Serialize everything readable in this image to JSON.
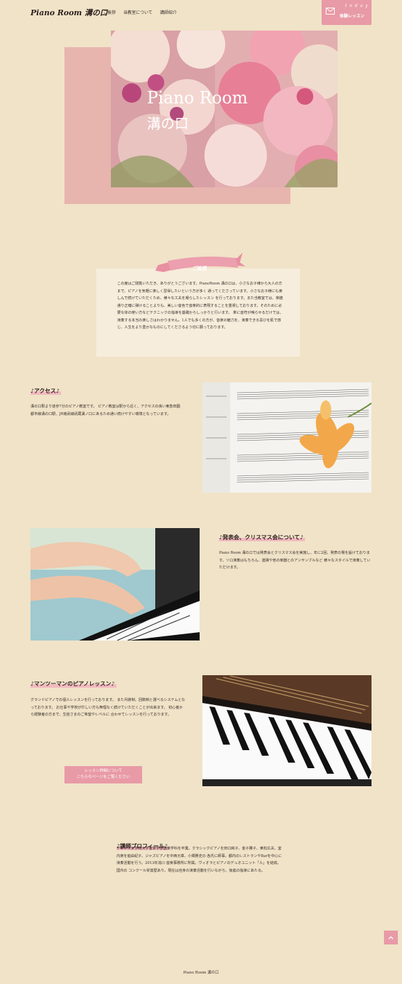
{
  "header": {
    "logo": "Piano Room 溝の口",
    "nav": [
      "ご挨拶",
      "当教室について",
      "講師紹介"
    ],
    "trial_top": "t o d a y",
    "trial_label": "体験レッスン"
  },
  "hero": {
    "title_en": "Piano Room",
    "title_jp": "溝の口"
  },
  "greeting": {
    "title": "ご挨拶",
    "text": "この度はご閲覧いただき、ありがとうございます。PianoRoom 溝の口は、小さなお子様から大人の方まで、ピアノを気軽に楽しく習得したいという方が多く 通ってくださっています。小さなお子様にも楽しんで続けていただくため、様々な工夫を凝らしたレッスン を行っております。また当教室では、楽譜通り正確に弾けることよりも、美しい音色で音楽的に表現することを重視しております。そのために必要な体の使い方などテクニックの指導を基礎からしっかりと行います。 単に音符が鳴らせるだけでは、演奏する本当の楽しさはわかりません。1人でも多くの方が、音楽の魅力を、演奏できる喜びを肌で感じ、人生をより豊かなものにしてくださるよう切に願っております。"
  },
  "access": {
    "title": "♪アクセス♪",
    "text": "溝の口駅より徒歩7分のピアノ教室です。 ピアノ教室は駅から近く、アクセスの良い東急田園都市線溝の口駅、JR南武線武蔵溝ノ口にあるため通い続けやすい環境となっています。"
  },
  "recital": {
    "title": "♪発表会、クリスマス会について♪",
    "text": "Piano Room 溝の口では発表会とクリスマス会を実施し、年に2回、発表の場を設けております。ソロ演奏はもちろん、連弾や他の楽器とのアンサンブルなど 様々なスタイルで演奏していただけます。"
  },
  "lesson": {
    "title": "♪マンツーマンのピアノレッスン♪",
    "text": "グランドピアノでの個人レッスンを行っております。 また月謝制、回数制と選べるシステムとなっております。 お仕事や学校が忙しい方も無理なく続けていただくことが出来ます。 初心者から経験者の方まで、生徒さまのご希望やレベルに 合わせてレッスンを行っております。",
    "button_line1": "レッスン詳細について",
    "button_line2": "こちらのページをご覧ください"
  },
  "profile": {
    "title": "♪講師プロフィール♪",
    "text": "フェリス女学院大学音楽学部器楽学科を卒業。クラシックピアノを田口純子、金子勝子、東松広夫、室内楽を舶由紀子、ジャズピアノを中西元章、小畑賢史の 各氏に師事。都内のレストランやBarを中心に演奏活動を行う。2013年浅川 音楽事務所に所属。ヴィオラとピアノのデュオユニット「人」を結成。国内の コンクール受賞歴あり。現在は自身の演奏活動を行いながら、後進の指導にあたる。"
  },
  "footer": {
    "text": "Piano Room 溝の口"
  },
  "colors": {
    "background": "#f0e3c8",
    "accent": "#e89aa6",
    "hero_block": "#e8b4ae"
  },
  "icons": {
    "trial": "envelope-icon",
    "scroll_top": "chevron-up-icon"
  }
}
